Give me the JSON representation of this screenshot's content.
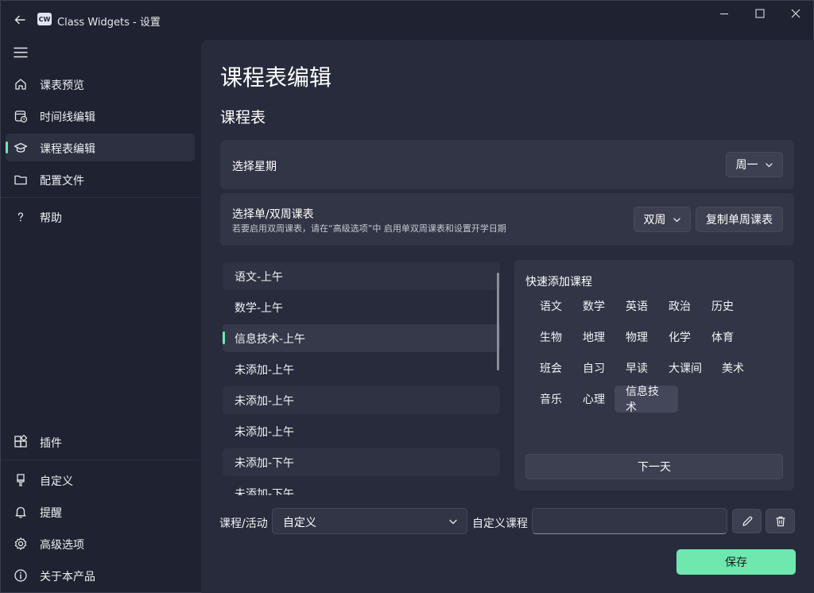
{
  "window": {
    "title": "Class Widgets - 设置",
    "logo_text": "CW"
  },
  "sidebar": {
    "top_items": [
      {
        "label": "课表预览",
        "icon": "home-icon"
      },
      {
        "label": "时间线编辑",
        "icon": "calendar-clock-icon"
      },
      {
        "label": "课程表编辑",
        "icon": "graduation-cap-icon",
        "active": true
      },
      {
        "label": "配置文件",
        "icon": "folder-icon"
      },
      {
        "label": "帮助",
        "icon": "question-icon"
      }
    ],
    "bottom_items": [
      {
        "label": "插件",
        "icon": "apps-add-icon"
      },
      {
        "label": "自定义",
        "icon": "brush-icon"
      },
      {
        "label": "提醒",
        "icon": "bell-icon"
      },
      {
        "label": "高级选项",
        "icon": "gear-icon"
      },
      {
        "label": "关于本产品",
        "icon": "info-icon"
      }
    ]
  },
  "main": {
    "page_title": "课程表编辑",
    "section_title": "课程表",
    "weekday_card": {
      "title": "选择星期",
      "selected": "周一"
    },
    "week_type_card": {
      "title": "选择单/双周课表",
      "subtitle": "若要启用双周课表，请在“高级选项”中 启用单双周课表和设置开学日期",
      "selected": "双周",
      "copy_button": "复制单周课表"
    },
    "lessons": [
      "语文-上午",
      "数学-上午",
      "信息技术-上午",
      "未添加-上午",
      "未添加-上午",
      "未添加-上午",
      "未添加-下午",
      "未添加-下午"
    ],
    "selected_lesson_index": 2,
    "quick_add": {
      "title": "快速添加课程",
      "courses": [
        "语文",
        "数学",
        "英语",
        "政治",
        "历史",
        "生物",
        "地理",
        "物理",
        "化学",
        "体育",
        "班会",
        "自习",
        "早读",
        "大课间",
        "美术",
        "音乐",
        "心理",
        "信息技术"
      ],
      "active_course": "信息技术",
      "next_day_button": "下一天"
    },
    "bottom": {
      "activity_label": "课程/活动",
      "activity_value": "自定义",
      "custom_label": "自定义课程",
      "custom_value": ""
    },
    "save_button": "保存"
  },
  "colors": {
    "accent": "#6fe8b0",
    "background": "#1f2231",
    "panel": "#282b3b",
    "card": "#323545"
  }
}
